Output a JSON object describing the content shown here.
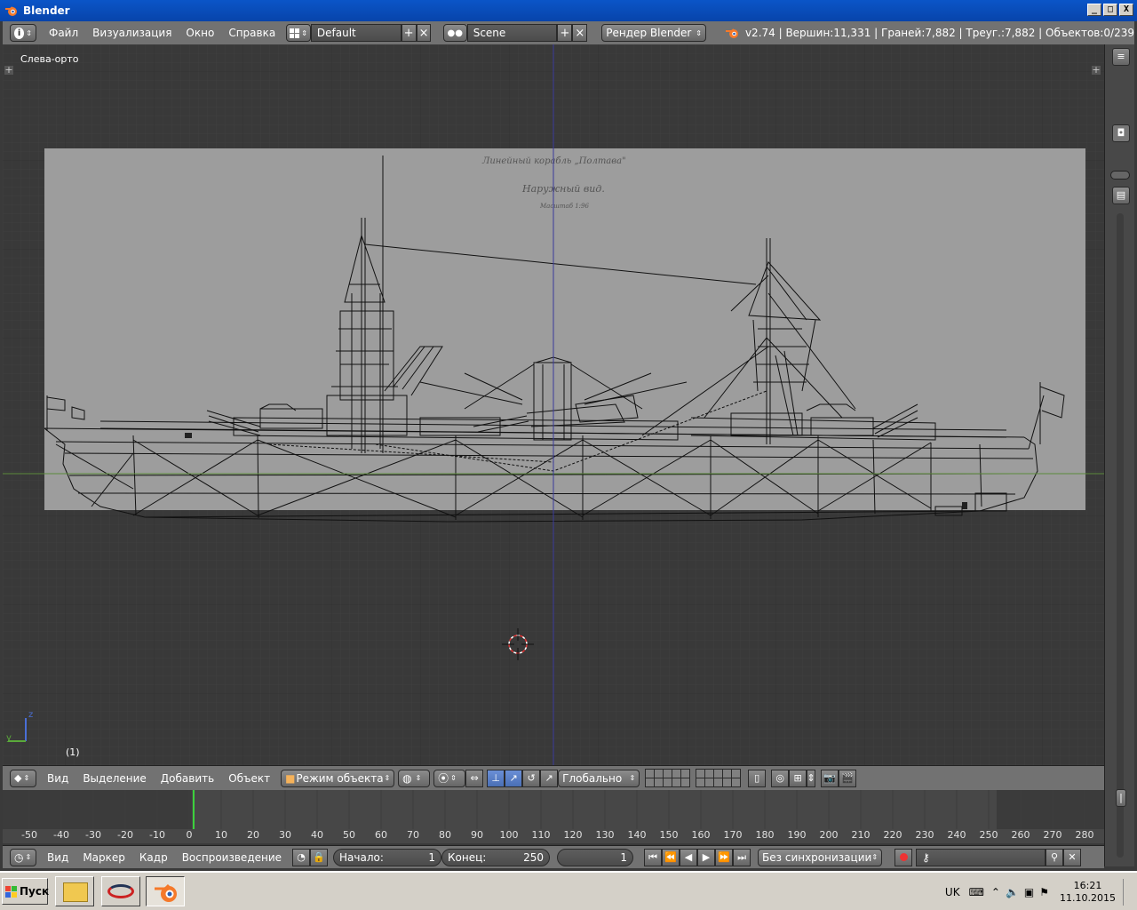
{
  "window": {
    "title": "Blender",
    "btn_min": "_",
    "btn_max": "□",
    "btn_close": "X"
  },
  "info_header": {
    "menus": [
      "Файл",
      "Визуализация",
      "Окно",
      "Справка"
    ],
    "layout_name": "Default",
    "scene_name": "Scene",
    "engine": "Рендер Blender",
    "stats": "v2.74 | Вершин:11,331 | Граней:7,882 | Треуг.:7,882 | Объектов:0/239"
  },
  "viewport": {
    "view_label": "Слева-орто",
    "frame_label": "(1)",
    "axis_z": "z",
    "axis_y": "y",
    "reference_texts": [
      "Линейный корабль „Полтава\"",
      "Наружный вид.",
      "Масштаб 1:96"
    ]
  },
  "view3d_header": {
    "menus": [
      "Вид",
      "Выделение",
      "Добавить",
      "Объект"
    ],
    "mode": "Режим объекта",
    "orientation": "Глобально"
  },
  "timeline": {
    "ticks": [
      "-50",
      "-40",
      "-30",
      "-20",
      "-10",
      "0",
      "10",
      "20",
      "30",
      "40",
      "50",
      "60",
      "70",
      "80",
      "90",
      "100",
      "110",
      "120",
      "130",
      "140",
      "150",
      "160",
      "170",
      "180",
      "190",
      "200",
      "210",
      "220",
      "230",
      "240",
      "250",
      "260",
      "270",
      "280"
    ],
    "current_frame_marker": "0"
  },
  "timeline_header": {
    "menus": [
      "Вид",
      "Маркер",
      "Кадр",
      "Воспроизведение"
    ],
    "start_label": "Начало:",
    "start_value": "1",
    "end_label": "Конец:",
    "end_value": "250",
    "current_frame": "1",
    "sync": "Без синхронизации"
  },
  "taskbar": {
    "start": "Пуск",
    "lang": "UK",
    "time": "16:21",
    "date": "11.10.2015"
  },
  "colors": {
    "viewport_bg": "#393939",
    "header_bg": "#727272",
    "reference_image": "#9d9d9d",
    "titlebar": "#0a55c8",
    "blender_orange": "#f5792a"
  }
}
